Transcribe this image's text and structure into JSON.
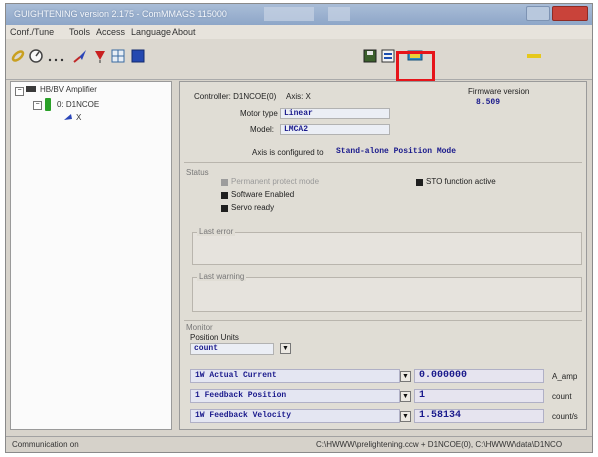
{
  "window": {
    "title": "GUIGHTENING version 2.175 - ComMMAGS 115000",
    "colors": {
      "titlebar": "#9fb4d1",
      "highlight": "#e6141a",
      "value_text": "#1a1a8c"
    }
  },
  "menu": [
    "Conf./Tune",
    "Tools",
    "Access",
    "Language",
    "About"
  ],
  "toolbar": {
    "left_icons": [
      "link-icon",
      "gauge-icon",
      "dots-icon",
      "plane-icon",
      "flag-icon",
      "grid-icon",
      "square-icon"
    ],
    "right_icons": [
      "save-icon",
      "transfer-icon",
      "monitor-icon",
      "key-icon"
    ]
  },
  "tree": {
    "root": "HB/BV Amplifier",
    "controller": "0: D1NCOE",
    "axis": "X"
  },
  "panel": {
    "controller_label": "Controller: D1NCOE(0)",
    "axis_label": "Axis: X",
    "firmware_label": "Firmware version",
    "firmware_value": "8.509",
    "motor_type_label": "Motor type",
    "motor_type_value": "Linear",
    "model_label": "Model:",
    "model_value": "LMCA2",
    "configured_label": "Axis is configured to",
    "configured_value": "Stand-alone Position Mode",
    "status_group": "Status",
    "status": [
      {
        "label": "Permanent protect mode",
        "active": false
      },
      {
        "label": "Software Enabled",
        "active": true
      },
      {
        "label": "Servo ready",
        "active": true
      }
    ],
    "sto_label": "STO function active",
    "last_error_group": "Last error",
    "last_warning_group": "Last warning",
    "monitor_group": "Monitor",
    "position_units_label": "Position Units",
    "position_units_value": "count",
    "monitor_rows": [
      {
        "signal": "1W Actual Current",
        "value": "0.000000",
        "unit": "A_amp"
      },
      {
        "signal": "1 Feedback Position",
        "value": "1",
        "unit": "count"
      },
      {
        "signal": "1W Feedback Velocity",
        "value": "1.58134",
        "unit": "count/s"
      }
    ]
  },
  "statusbar": {
    "left": "Communication on",
    "right": "C:\\HWWW\\prelightening.ccw + D1NCOE(0), C:\\HWWW\\data\\D1NCO"
  }
}
